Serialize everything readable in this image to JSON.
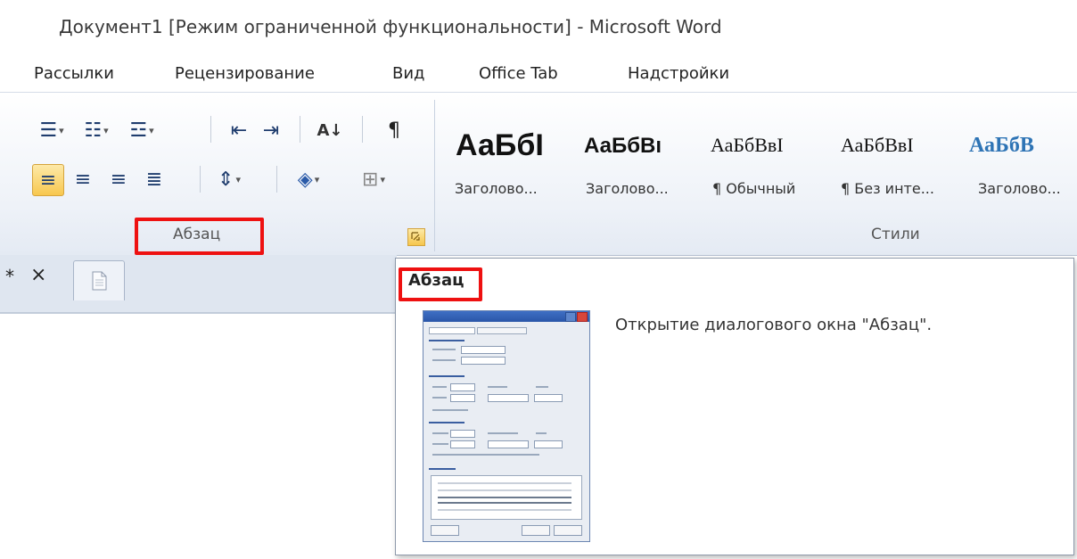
{
  "window": {
    "title": "Документ1 [Режим ограниченной функциональности]  -  Microsoft Word"
  },
  "menu": {
    "items": [
      "Рассылки",
      "Рецензирование",
      "Вид",
      "Office Tab",
      "Надстройки"
    ]
  },
  "ribbon": {
    "paragraph_group": {
      "label": "Абзац",
      "sort_glyph": "А↓",
      "pilcrow": "¶"
    },
    "styles_group": {
      "label": "Стили",
      "items": [
        {
          "sample": "АаБбI",
          "name": "Заголово..."
        },
        {
          "sample": "АаБбВı",
          "name": "Заголово..."
        },
        {
          "sample": "АаБбВвI",
          "name": "¶ Обычный"
        },
        {
          "sample": "АаБбВвI",
          "name": "¶ Без инте..."
        },
        {
          "sample": "АаБбВ",
          "name": "Заголово..."
        }
      ]
    }
  },
  "tabs": {
    "modified_marker": "*",
    "close_glyph": "×"
  },
  "tooltip": {
    "title": "Абзац",
    "description": "Открытие диалогового окна \"Абзац\"."
  },
  "colors": {
    "accent": "#ee1111",
    "ribbon_bg": "#eef2f8",
    "style_blue": "#2e74b5"
  }
}
